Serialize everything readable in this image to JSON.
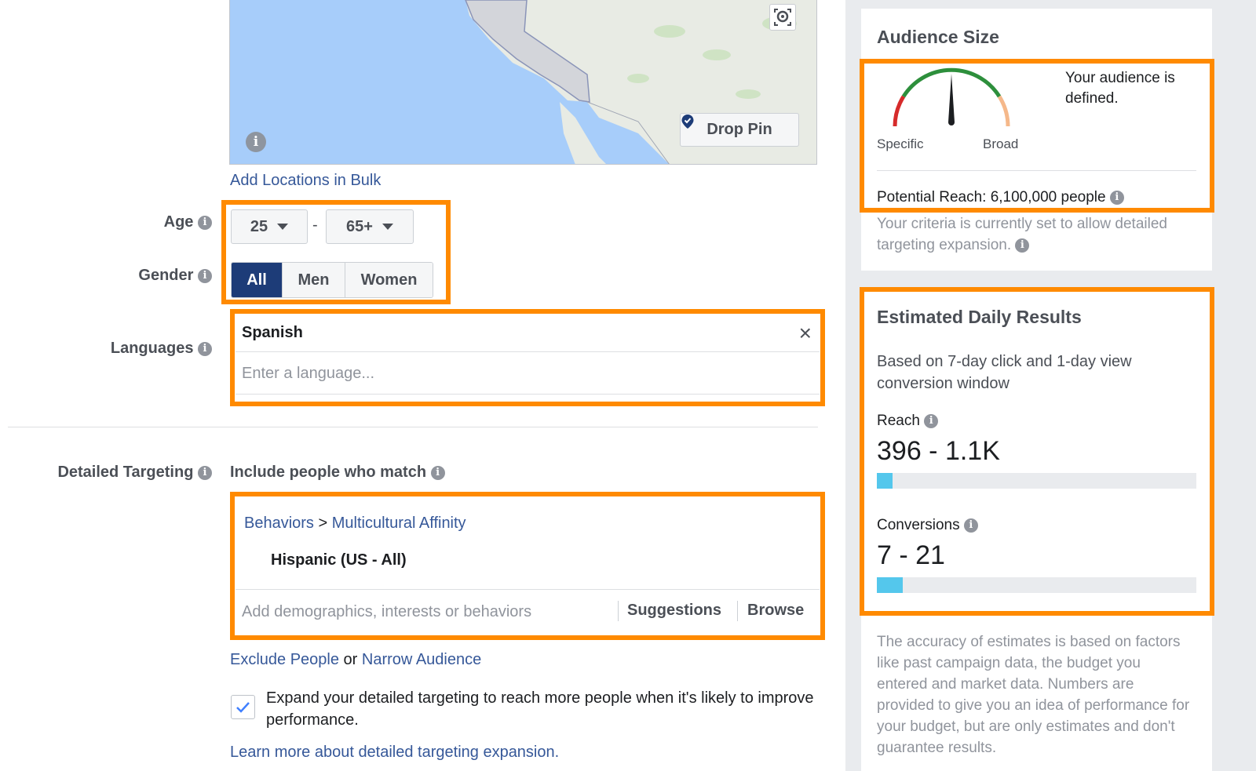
{
  "location": {
    "drop_pin_label": "Drop Pin",
    "add_bulk_link": "Add Locations in Bulk"
  },
  "age": {
    "label": "Age",
    "min": "25",
    "separator": "-",
    "max": "65+"
  },
  "gender": {
    "label": "Gender",
    "options": [
      "All",
      "Men",
      "Women"
    ],
    "selected": "All"
  },
  "languages": {
    "label": "Languages",
    "selected": "Spanish",
    "placeholder": "Enter a language..."
  },
  "detailed_targeting": {
    "label": "Detailed Targeting",
    "include_label": "Include people who match",
    "path": [
      "Behaviors",
      "Multicultural Affinity"
    ],
    "path_separator": ">",
    "item": "Hispanic (US - All)",
    "placeholder": "Add demographics, interests or behaviors",
    "suggestions_label": "Suggestions",
    "browse_label": "Browse",
    "exclude_link": "Exclude People",
    "or_text": "or",
    "narrow_link": "Narrow Audience",
    "expand_text": "Expand your detailed targeting to reach more people when it's likely to improve performance.",
    "expand_checked": true,
    "learn_more_link": "Learn more about detailed targeting expansion."
  },
  "audience_size": {
    "title": "Audience Size",
    "status": "Your audience is defined.",
    "specific_label": "Specific",
    "broad_label": "Broad",
    "potential_reach": "Potential Reach: 6,100,000 people",
    "criteria_text": "Your criteria is currently set to allow detailed targeting expansion."
  },
  "estimated_daily_results": {
    "title": "Estimated Daily Results",
    "subtitle": "Based on 7-day click and 1-day view conversion window",
    "reach_label": "Reach",
    "reach_value": "396 - 1.1K",
    "reach_fill_fraction": 0.05,
    "conversions_label": "Conversions",
    "conversions_value": "7 - 21",
    "conversions_fill_fraction": 0.08,
    "disclaimer": "The accuracy of estimates is based on factors like past campaign data, the budget you entered and market data. Numbers are provided to give you an idea of performance for your budget, but are only estimates and don't guarantee results."
  },
  "colors": {
    "highlight": "#ff8a00",
    "link": "#365899",
    "selected_segment": "#1d3c78",
    "bar_fill": "#54c7ec"
  }
}
